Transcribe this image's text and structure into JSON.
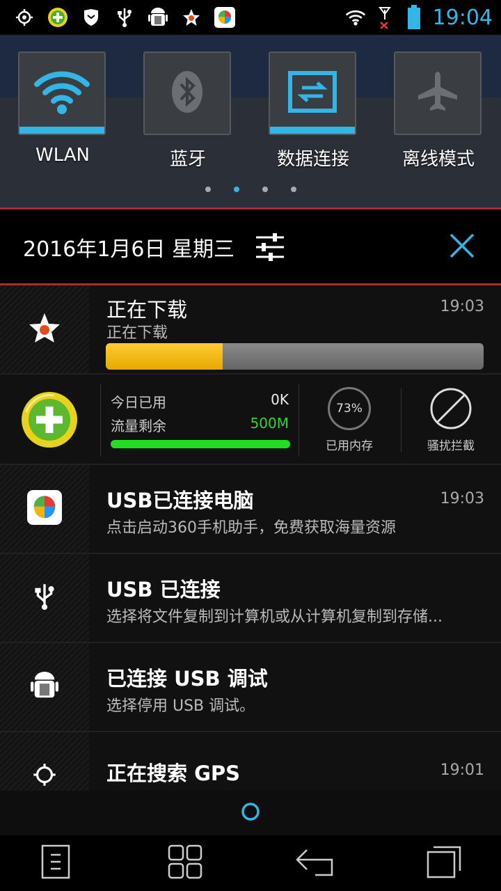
{
  "status_bar": {
    "time": "19:04",
    "left_icons": [
      "gps-icon",
      "360-security-icon",
      "shield-icon",
      "usb-icon",
      "android-debug-icon",
      "star-download-icon",
      "360-assistant-icon"
    ],
    "right_icons": [
      "wifi-icon",
      "no-signal-icon",
      "battery-icon"
    ]
  },
  "quick_settings": {
    "tiles": [
      {
        "label": "WLAN",
        "icon": "wifi-icon",
        "on": true
      },
      {
        "label": "蓝牙",
        "icon": "bluetooth-icon",
        "on": false
      },
      {
        "label": "数据连接",
        "icon": "data-connection-icon",
        "on": true
      },
      {
        "label": "离线模式",
        "icon": "airplane-icon",
        "on": false
      }
    ],
    "page_count": 4,
    "active_page": 2
  },
  "header": {
    "date": "2016年1月6日 星期三"
  },
  "notifications": {
    "download": {
      "title": "正在下载",
      "subtitle": "正在下载",
      "time": "19:03",
      "progress": 0.31
    },
    "widget_360": {
      "today_used_label": "今日已用",
      "today_used_value": "0K",
      "remaining_label": "流量剩余",
      "remaining_value": "500M",
      "memory_percent": "73%",
      "memory_label": "已用内存",
      "block_label": "骚扰拦截"
    },
    "usb_pc": {
      "title": "USB已连接电脑",
      "subtitle": "点击启动360手机助手，免费获取海量资源",
      "time": "19:03"
    },
    "usb": {
      "title": "USB 已连接",
      "subtitle": "选择将文件复制到计算机或从计算机复制到存储..."
    },
    "usb_debug": {
      "title": "已连接 USB 调试",
      "subtitle": "选择停用 USB 调试。"
    },
    "gps": {
      "title": "正在搜索 GPS",
      "time": "19:01"
    }
  },
  "navbar": {
    "buttons": [
      "menu-icon",
      "home-icon",
      "back-icon",
      "recents-icon"
    ]
  },
  "colors": {
    "accent": "#33b5e5",
    "divider_red": "#b02a2a",
    "progress_yellow": "#ffcc33",
    "green": "#22dd22"
  }
}
